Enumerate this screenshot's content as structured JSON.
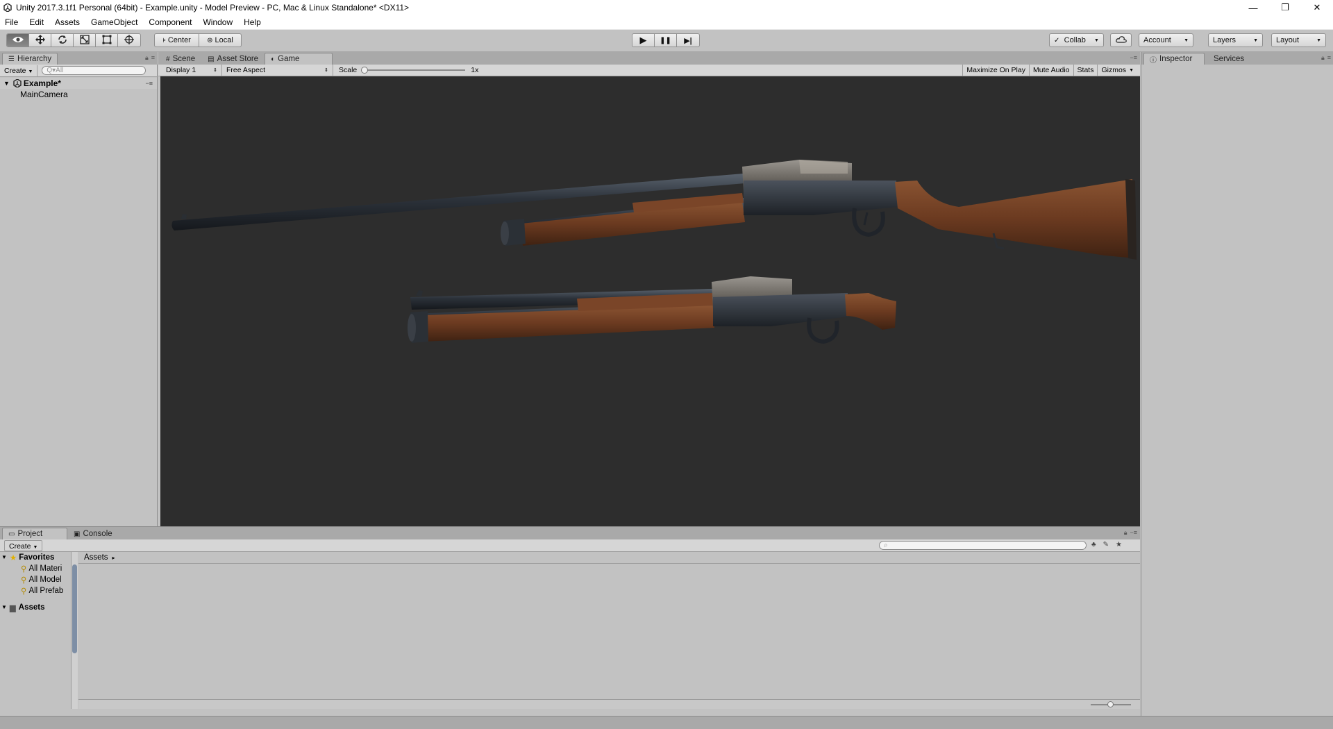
{
  "window": {
    "title": "Unity 2017.3.1f1 Personal (64bit) - Example.unity - Model Preview - PC, Mac & Linux Standalone* <DX11>",
    "minimize": "—",
    "maximize": "❐",
    "close": "✕"
  },
  "menu": [
    "File",
    "Edit",
    "Assets",
    "GameObject",
    "Component",
    "Window",
    "Help"
  ],
  "toolbar": {
    "tools": [
      "hand-view-tool",
      "move-tool",
      "rotate-tool",
      "scale-tool",
      "rect-tool",
      "transform-tool"
    ],
    "pivot_label": "Center",
    "space_label": "Local",
    "play_icon": "▶",
    "pause_icon": "❚❚",
    "step_icon": "▶|",
    "collab_label": "Collab",
    "account_label": "Account",
    "layers_label": "Layers",
    "layout_label": "Layout"
  },
  "hierarchy": {
    "tab_label": "Hierarchy",
    "create_label": "Create",
    "search_placeholder": "Q▾All",
    "scene_name": "Example*",
    "items": [
      "MainCamera"
    ]
  },
  "center_tabs": {
    "scene": "Scene",
    "asset_store": "Asset Store",
    "game": "Game"
  },
  "game_controls": {
    "display": "Display 1",
    "aspect": "Free Aspect",
    "scale_label": "Scale",
    "scale_value": "1x",
    "maximize_on_play": "Maximize On Play",
    "mute_audio": "Mute Audio",
    "stats": "Stats",
    "gizmos": "Gizmos"
  },
  "inspector": {
    "tab_label": "Inspector",
    "services_label": "Services"
  },
  "project": {
    "tab_label": "Project",
    "console_label": "Console",
    "create_label": "Create",
    "favorites_label": "Favorites",
    "favorites": [
      "All Materi",
      "All Model",
      "All Prefab"
    ],
    "assets_label": "Assets",
    "breadcrumb": "Assets"
  },
  "colors": {
    "editor_bg": "#c2c2c2",
    "viewport_bg": "#2d2d2d",
    "wood": "#6b3a20",
    "metal": "#2a2f36"
  }
}
